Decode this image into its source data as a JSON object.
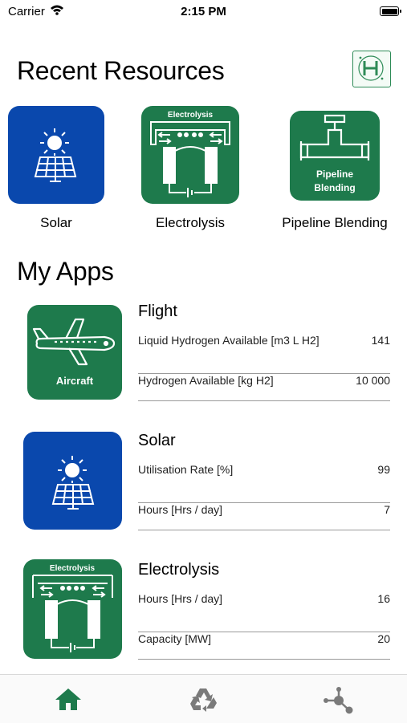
{
  "status_bar": {
    "carrier": "Carrier",
    "time": "2:15 PM"
  },
  "recent": {
    "title": "Recent Resources",
    "items": [
      {
        "label": "Solar",
        "icon": "solar-panel-icon"
      },
      {
        "label": "Electrolysis",
        "icon": "electrolysis-icon",
        "badge": "Electrolysis"
      },
      {
        "label": "Pipeline Blending",
        "icon": "pipeline-icon",
        "badge_line1": "Pipeline",
        "badge_line2": "Blending"
      }
    ]
  },
  "my_apps": {
    "title": "My Apps",
    "apps": [
      {
        "title": "Flight",
        "icon": "aircraft-icon",
        "icon_label": "Aircraft",
        "metrics": [
          {
            "label": "Liquid Hydrogen Available [m3 L H2]",
            "value": "141"
          },
          {
            "label": "Hydrogen Available [kg H2]",
            "value": "10 000"
          }
        ]
      },
      {
        "title": "Solar",
        "icon": "solar-panel-icon",
        "metrics": [
          {
            "label": "Utilisation Rate [%]",
            "value": "99"
          },
          {
            "label": "Hours [Hrs / day]",
            "value": "7"
          }
        ]
      },
      {
        "title": "Electrolysis",
        "icon": "electrolysis-icon",
        "icon_label": "Electrolysis",
        "metrics": [
          {
            "label": "Hours [Hrs / day]",
            "value": "16"
          },
          {
            "label": "Capacity [MW]",
            "value": "20"
          }
        ]
      }
    ]
  },
  "tabbar": {
    "items": [
      {
        "icon": "home-icon",
        "active": true
      },
      {
        "icon": "recycle-icon",
        "active": false
      },
      {
        "icon": "network-icon",
        "active": false
      }
    ]
  },
  "colors": {
    "green": "#1e7a4c",
    "blue": "#0a48ad",
    "active_tab": "#1e7a4c",
    "inactive_tab": "#7a7a7a"
  }
}
